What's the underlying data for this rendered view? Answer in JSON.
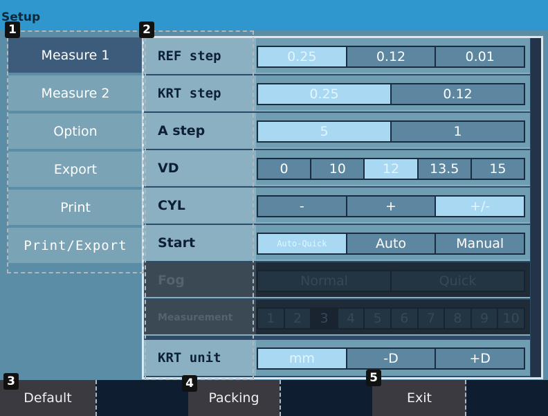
{
  "window": {
    "title": "Setup"
  },
  "nav": {
    "items": [
      "Measure 1",
      "Measure 2",
      "Option",
      "Export",
      "Print",
      "Print/Export"
    ],
    "active": 0
  },
  "rows": {
    "ref": {
      "label": "REF step",
      "opts": [
        "0.25",
        "0.12",
        "0.01"
      ],
      "sel": 0
    },
    "krt": {
      "label": "KRT step",
      "opts": [
        "0.25",
        "0.12"
      ],
      "sel": 0
    },
    "astep": {
      "label": "A step",
      "opts": [
        "5",
        "1"
      ],
      "sel": 0
    },
    "vd": {
      "label": "VD",
      "opts": [
        "0",
        "10",
        "12",
        "13.5",
        "15"
      ],
      "sel": 2
    },
    "cyl": {
      "label": "CYL",
      "opts": [
        "-",
        "+",
        "+/-"
      ],
      "sel": 2
    },
    "start": {
      "label": "Start",
      "opts": [
        "Auto-Quick",
        "Auto",
        "Manual"
      ],
      "sel": 0
    },
    "fog": {
      "label": "Fog",
      "opts": [
        "Normal",
        "Quick"
      ],
      "disabled": true
    },
    "meas": {
      "label": "Measurement",
      "opts": [
        "1",
        "2",
        "3",
        "4",
        "5",
        "6",
        "7",
        "8",
        "9",
        "10"
      ],
      "disabled": true
    },
    "krtunit": {
      "label": "KRT unit",
      "opts": [
        "mm",
        "-D",
        "+D"
      ],
      "sel": 0
    }
  },
  "bottom": {
    "default": "Default",
    "packing": "Packing",
    "exit": "Exit"
  },
  "badges": [
    "1",
    "2",
    "3",
    "4",
    "5"
  ]
}
